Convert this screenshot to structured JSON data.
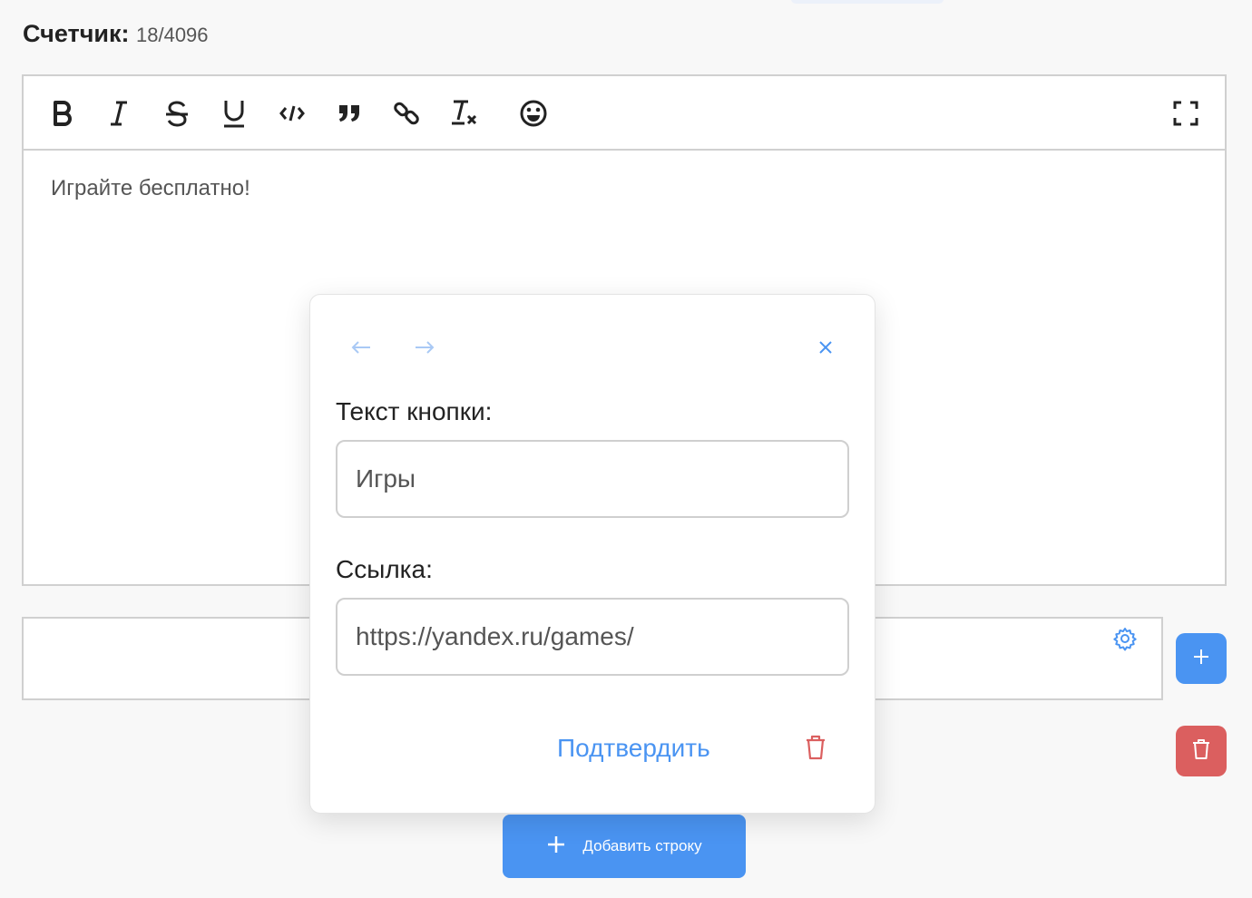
{
  "counter": {
    "label": "Счетчик:",
    "value": "18/4096"
  },
  "editor": {
    "toolbar": [
      "bold-icon",
      "italic-icon",
      "strikethrough-icon",
      "underline-icon",
      "code-icon",
      "quote-icon",
      "link-icon",
      "clear-format-icon",
      "emoji-icon",
      "fullscreen-icon"
    ],
    "content": "Играйте бесплатно!"
  },
  "modal": {
    "button_text_label": "Текст кнопки:",
    "button_text_value": "Игры",
    "link_label": "Ссылка:",
    "link_value": "https://yandex.ru/games/",
    "confirm_label": "Подтвердить"
  },
  "add_row": {
    "label": "Добавить строку"
  },
  "colors": {
    "accent": "#4a94f2",
    "danger": "#db5f5f",
    "border": "#d0d0d0"
  }
}
